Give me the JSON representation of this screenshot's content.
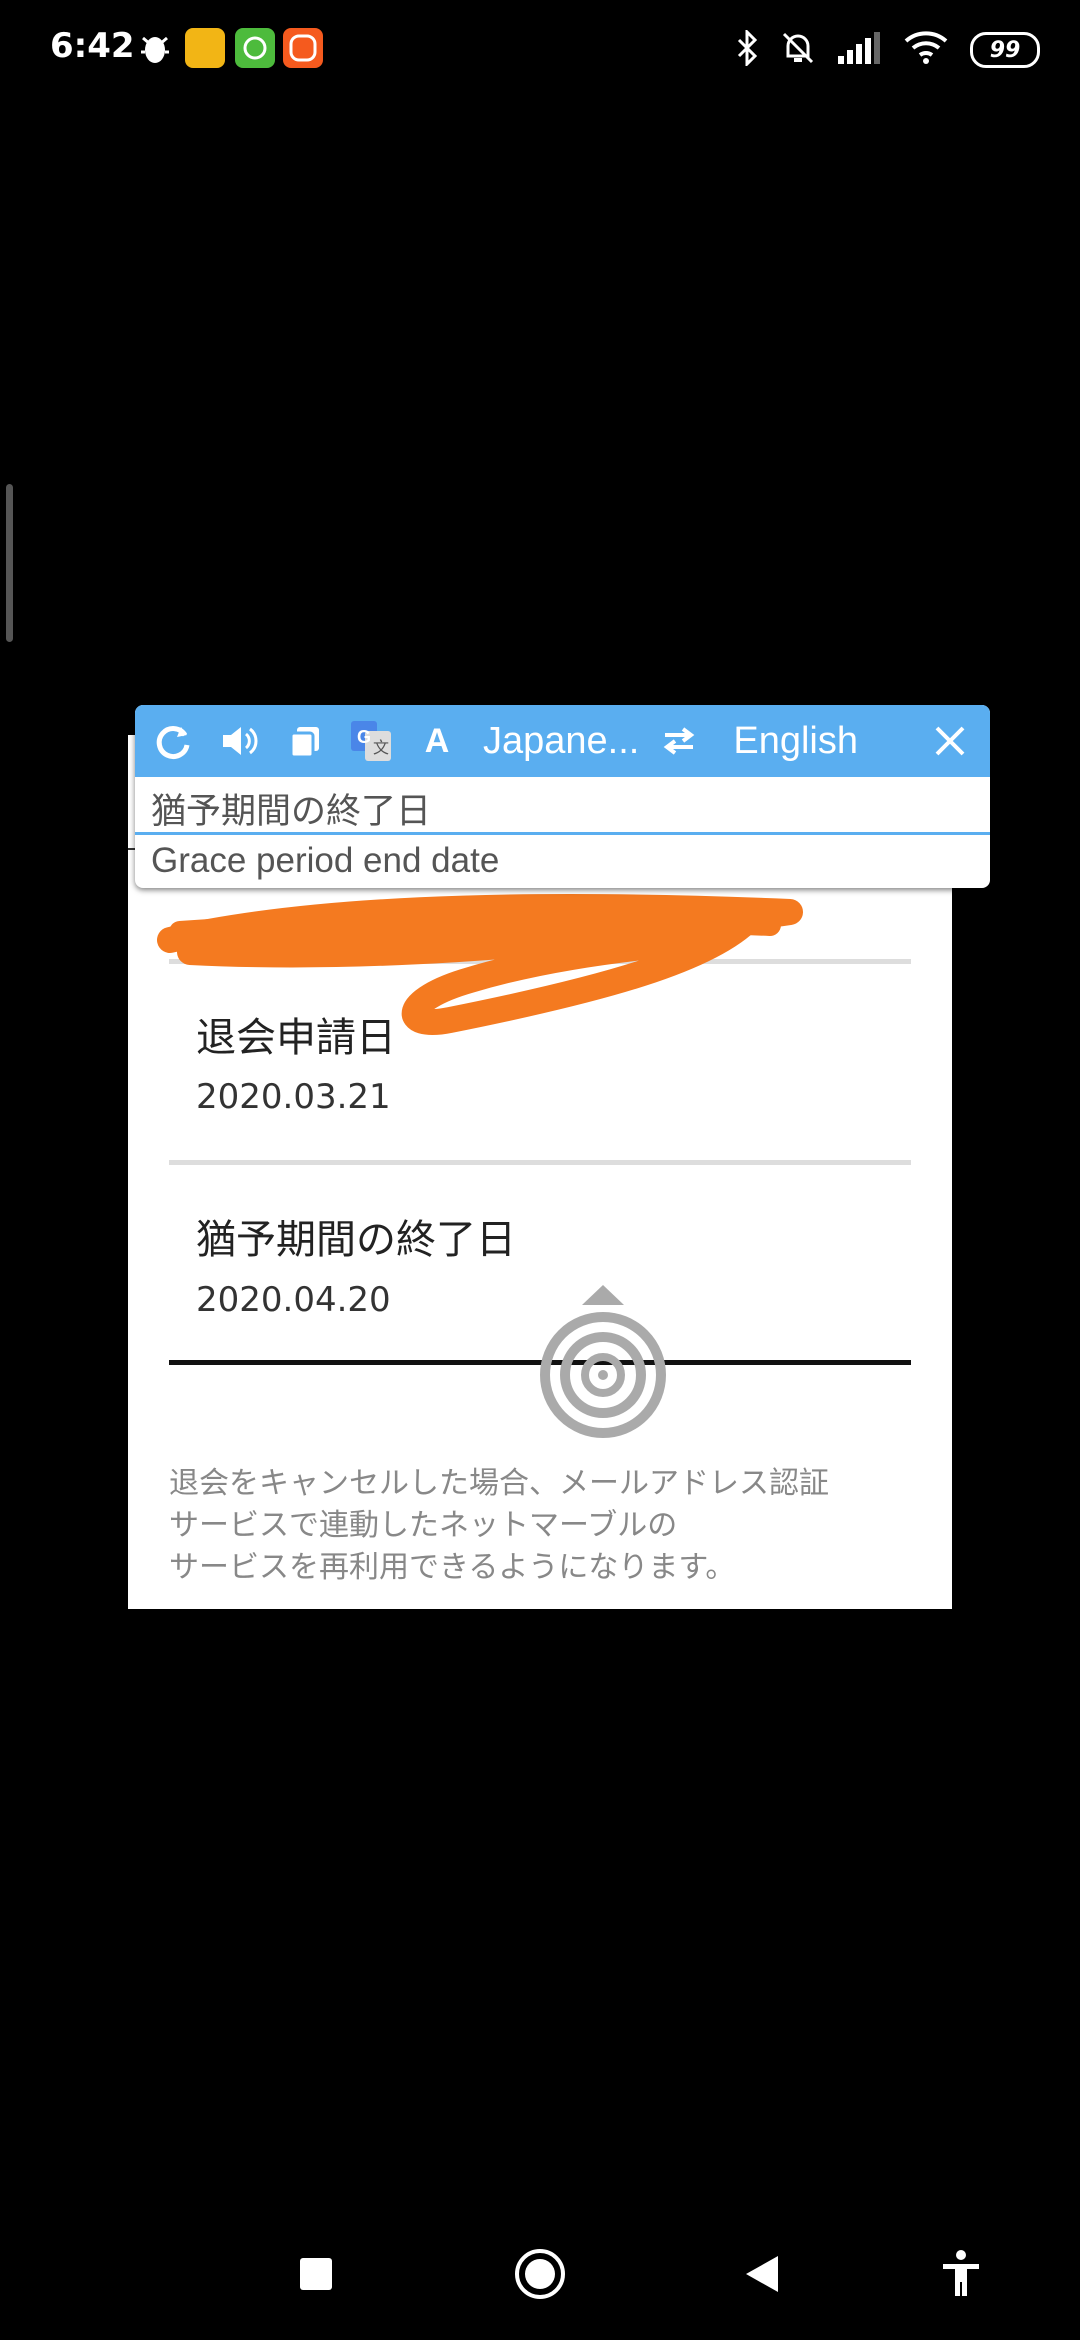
{
  "status_bar": {
    "time": "6:42",
    "battery": "99",
    "icons": [
      "bug-icon",
      "app-icon-yellow",
      "app-icon-green",
      "app-icon-orange",
      "bluetooth-icon",
      "mute-icon",
      "signal-icon",
      "wifi-icon",
      "battery-icon"
    ]
  },
  "translator": {
    "source_lang": "Japane...",
    "target_lang": "English",
    "source_text": "猶予期間の終了日",
    "translated_text": "Grace period end date",
    "icons": [
      "refresh-icon",
      "speaker-icon",
      "copy-icon",
      "google-translate-icon",
      "font-icon",
      "swap-icon",
      "close-icon"
    ]
  },
  "card": {
    "fields": [
      {
        "label": "退会申請日",
        "value": "2020.03.21"
      },
      {
        "label": "猶予期間の終了日",
        "value": "2020.04.20"
      }
    ],
    "note_lines": [
      "退会をキャンセルした場合、メールアドレス認証",
      "サービスで連動したネットマーブルの",
      "サービスを再利用できるようになります。"
    ]
  },
  "colors": {
    "accent": "#5aaef0",
    "scribble": "#f47a20"
  },
  "nav": [
    "recents-button",
    "home-button",
    "back-button",
    "accessibility-button"
  ]
}
